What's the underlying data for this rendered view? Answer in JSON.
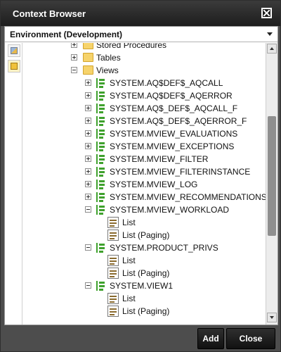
{
  "window": {
    "title": "Context Browser"
  },
  "environment": {
    "selected": "Environment (Development)"
  },
  "tree": {
    "stored_procedures": "Stored Procedures",
    "tables": "Tables",
    "views": "Views",
    "view_items": [
      "SYSTEM.AQ$DEF$_AQCALL",
      "SYSTEM.AQ$DEF$_AQERROR",
      "SYSTEM.AQ$_DEF$_AQCALL_F",
      "SYSTEM.AQ$_DEF$_AQERROR_F",
      "SYSTEM.MVIEW_EVALUATIONS",
      "SYSTEM.MVIEW_EXCEPTIONS",
      "SYSTEM.MVIEW_FILTER",
      "SYSTEM.MVIEW_FILTERINSTANCE",
      "SYSTEM.MVIEW_LOG",
      "SYSTEM.MVIEW_RECOMMENDATIONS",
      "SYSTEM.MVIEW_WORKLOAD",
      "SYSTEM.PRODUCT_PRIVS",
      "SYSTEM.VIEW1"
    ],
    "child_list": "List",
    "child_list_paging": "List (Paging)"
  },
  "footer": {
    "add_label": "Add",
    "close_label": "Close"
  },
  "icons": {
    "close": "close-icon",
    "folder": "folder-icon",
    "view": "view-icon",
    "list": "list-icon"
  },
  "colors": {
    "titlebar": "#2a2a2a",
    "accent": "#3fa12d",
    "folder": "#f6d36b"
  }
}
